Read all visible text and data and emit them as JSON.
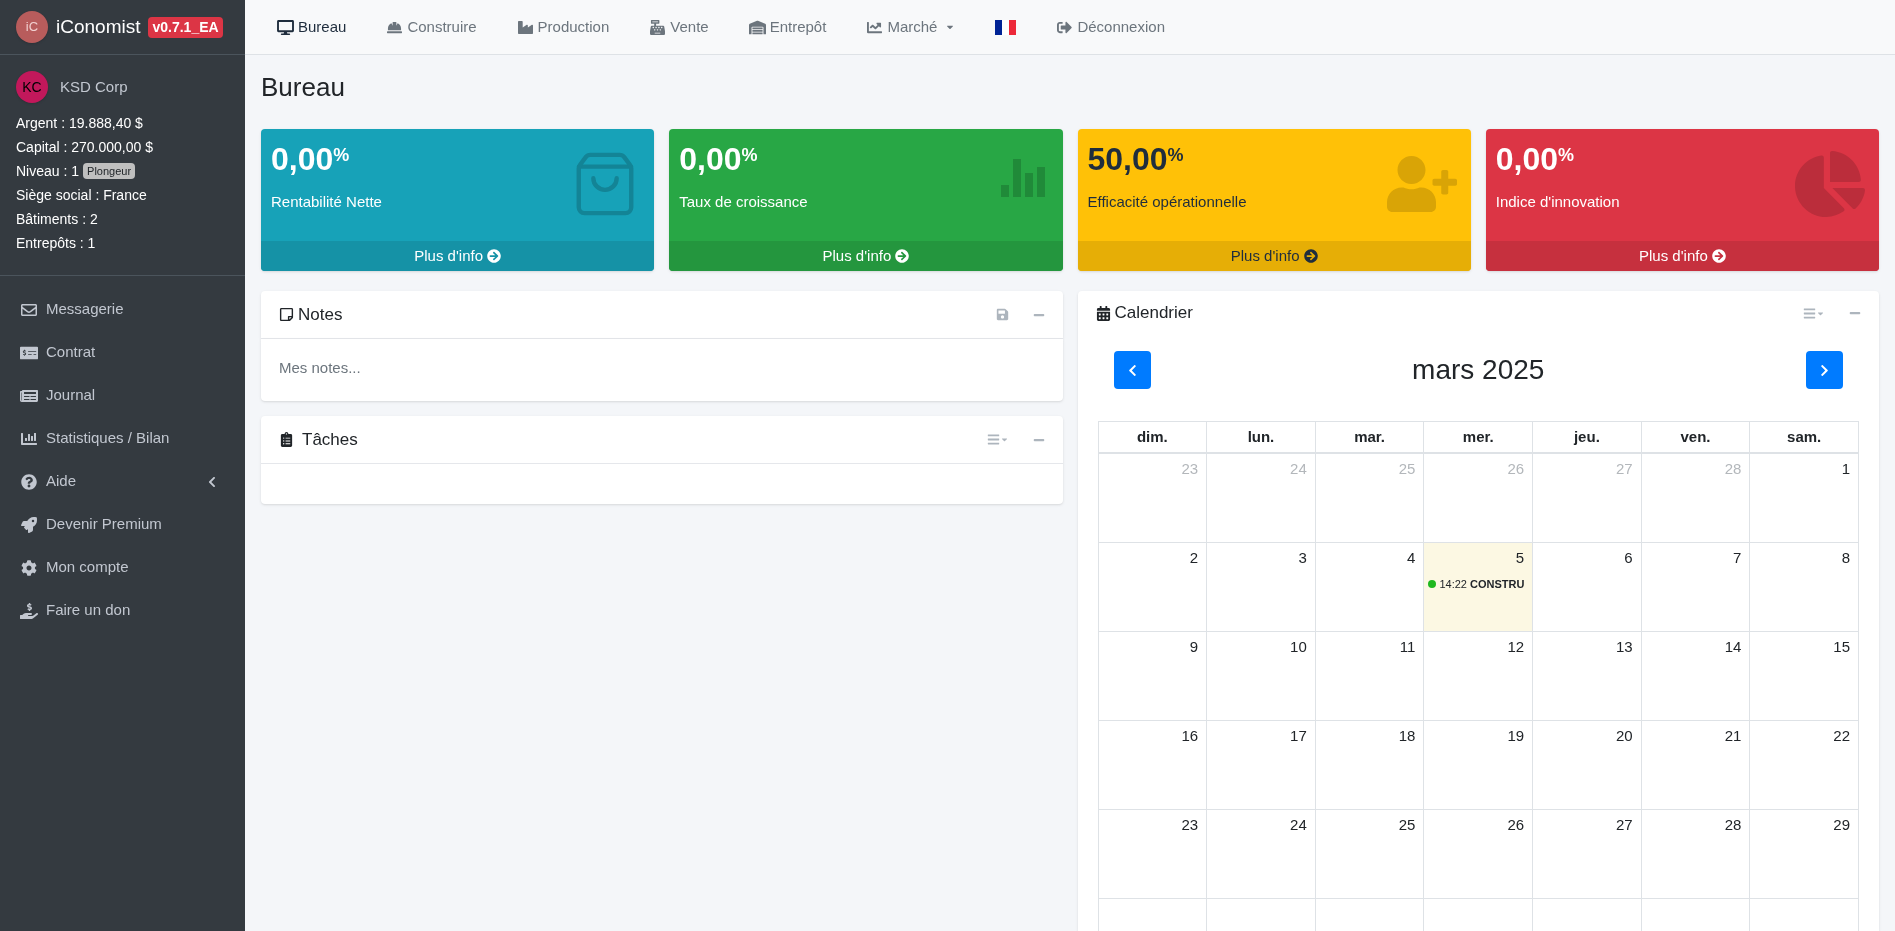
{
  "brand": {
    "logo": "iC",
    "name": "iConomist",
    "version": "v0.7.1_EA"
  },
  "user": {
    "initials": "KC",
    "name": "KSD Corp"
  },
  "stats": [
    {
      "label": "Argent : 19.888,40 $"
    },
    {
      "label": "Capital : 270.000,00 $"
    },
    {
      "label": "Niveau : 1",
      "badge": "Plongeur"
    },
    {
      "label": "Siège social : France"
    },
    {
      "label": "Bâtiments : 2"
    },
    {
      "label": "Entrepôts : 1"
    }
  ],
  "sidebar": {
    "items": [
      {
        "label": "Messagerie"
      },
      {
        "label": "Contrat"
      },
      {
        "label": "Journal"
      },
      {
        "label": "Statistiques / Bilan"
      },
      {
        "label": "Aide",
        "expanded": false
      },
      {
        "label": "Devenir Premium"
      },
      {
        "label": "Mon compte"
      },
      {
        "label": "Faire un don"
      }
    ]
  },
  "navbar": {
    "items": [
      {
        "kind": "link",
        "label": "Bureau",
        "selected": true
      },
      {
        "kind": "link",
        "label": "Construire",
        "selected": false
      },
      {
        "kind": "link",
        "label": "Production",
        "selected": false
      },
      {
        "kind": "link",
        "label": "Vente",
        "selected": false
      },
      {
        "kind": "link",
        "label": "Entrepôt",
        "selected": false
      },
      {
        "kind": "dropdown",
        "label": "Marché",
        "selected": false
      },
      {
        "kind": "flag"
      },
      {
        "kind": "link",
        "label": "Déconnexion",
        "selected": false
      }
    ]
  },
  "page_title": "Bureau",
  "cards": [
    {
      "value": "0,00$^{%}$",
      "label": "Rentabilité Nette",
      "link": "Plus d'info"
    },
    {
      "value": "0,00$^{%}$",
      "label": "Taux de croissance",
      "link": "Plus d'info"
    },
    {
      "value": "50,00$^{%}$",
      "label": "Efficacité opérationnelle",
      "link": "Plus d'info"
    },
    {
      "value": "0,00$^{%}$",
      "label": "Indice d'innovation",
      "link": "Plus d'info"
    }
  ],
  "notes": {
    "title": "Notes",
    "placeholder": "Mes notes..."
  },
  "tasks": {
    "title": "Tâches"
  },
  "calendar": {
    "title": "Calendrier",
    "month": "mars 2025",
    "weekdays": [
      "dim.",
      "lun.",
      "mar.",
      "mer.",
      "jeu.",
      "ven.",
      "sam."
    ],
    "weeks": [
      [
        {
          "day": "23",
          "other_month": true,
          "today": false
        },
        {
          "day": "24",
          "other_month": true,
          "today": false
        },
        {
          "day": "25",
          "other_month": true,
          "today": false
        },
        {
          "day": "26",
          "other_month": true,
          "today": false
        },
        {
          "day": "27",
          "other_month": true,
          "today": false
        },
        {
          "day": "28",
          "other_month": true,
          "today": false
        },
        {
          "day": "1",
          "other_month": false,
          "today": false
        }
      ],
      [
        {
          "day": "2",
          "other_month": false,
          "today": false
        },
        {
          "day": "3",
          "other_month": false,
          "today": false
        },
        {
          "day": "4",
          "other_month": false,
          "today": false
        },
        {
          "day": "5",
          "other_month": false,
          "today": true,
          "events": [
            {
              "time": "14:22",
              "title": "CONSTRU",
              "color": "#1fb81f"
            }
          ]
        },
        {
          "day": "6",
          "other_month": false,
          "today": false
        },
        {
          "day": "7",
          "other_month": false,
          "today": false
        },
        {
          "day": "8",
          "other_month": false,
          "today": false
        }
      ],
      [
        {
          "day": "9",
          "other_month": false,
          "today": false
        },
        {
          "day": "10",
          "other_month": false,
          "today": false
        },
        {
          "day": "11",
          "other_month": false,
          "today": false
        },
        {
          "day": "12",
          "other_month": false,
          "today": false
        },
        {
          "day": "13",
          "other_month": false,
          "today": false
        },
        {
          "day": "14",
          "other_month": false,
          "today": false
        },
        {
          "day": "15",
          "other_month": false,
          "today": false
        }
      ],
      [
        {
          "day": "16",
          "other_month": false,
          "today": false
        },
        {
          "day": "17",
          "other_month": false,
          "today": false
        },
        {
          "day": "18",
          "other_month": false,
          "today": false
        },
        {
          "day": "19",
          "other_month": false,
          "today": false
        },
        {
          "day": "20",
          "other_month": false,
          "today": false
        },
        {
          "day": "21",
          "other_month": false,
          "today": false
        },
        {
          "day": "22",
          "other_month": false,
          "today": false
        }
      ],
      [
        {
          "day": "23",
          "other_month": false,
          "today": false
        },
        {
          "day": "24",
          "other_month": false,
          "today": false
        },
        {
          "day": "25",
          "other_month": false,
          "today": false
        },
        {
          "day": "26",
          "other_month": false,
          "today": false
        },
        {
          "day": "27",
          "other_month": false,
          "today": false
        },
        {
          "day": "28",
          "other_month": false,
          "today": false
        },
        {
          "day": "29",
          "other_month": false,
          "today": false
        }
      ]
    ]
  }
}
